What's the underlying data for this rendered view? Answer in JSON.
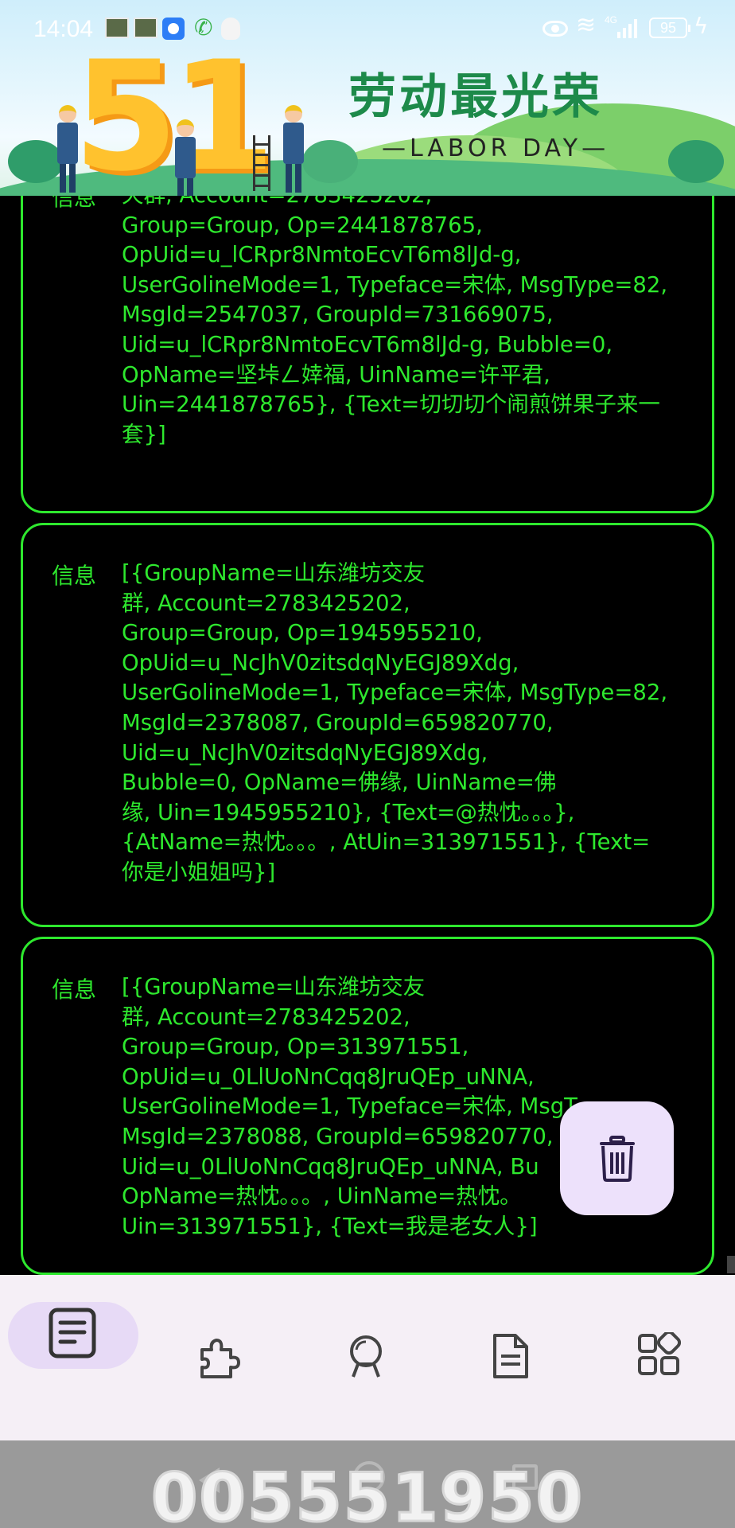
{
  "status_bar": {
    "time": "14:04",
    "network_label": "4G",
    "battery": "95"
  },
  "banner": {
    "big_number": "51",
    "slogan_cn": "劳动最光荣",
    "slogan_en": "—LABOR DAY—"
  },
  "messages": [
    {
      "label": "信息",
      "text": "天群, Account=2783425202,\nGroup=Group, Op=2441878765,\nOpUid=u_lCRpr8NmtoEcvT6m8lJd-g,\nUserGolineMode=1, Typeface=宋体, MsgType=82,\nMsgId=2547037, GroupId=731669075,\nUid=u_lCRpr8NmtoEcvT6m8lJd-g, Bubble=0,\nOpName=坚垰ㄥ婞福, UinName=许平君,\nUin=2441878765}, {Text=切切切个闹煎饼果子来一\n套}]"
    },
    {
      "label": "信息",
      "text": "[{GroupName=山东潍坊交友\n群, Account=2783425202,\nGroup=Group, Op=1945955210,\nOpUid=u_NcJhV0zitsdqNyEGJ89Xdg,\nUserGolineMode=1, Typeface=宋体, MsgType=82,\nMsgId=2378087, GroupId=659820770,\nUid=u_NcJhV0zitsdqNyEGJ89Xdg,\nBubble=0, OpName=佛缘, UinName=佛\n缘, Uin=1945955210}, {Text=@热忱。。。},\n{AtName=热忱。。。, AtUin=313971551}, {Text=\n你是小姐姐吗}]"
    },
    {
      "label": "信息",
      "text": "[{GroupName=山东潍坊交友\n群, Account=2783425202,\nGroup=Group, Op=313971551,\nOpUid=u_0LlUoNnCqq8JruQEp_uNNA,\nUserGolineMode=1, Typeface=宋体, MsgT\nMsgId=2378088, GroupId=659820770,\nUid=u_0LlUoNnCqq8JruQEp_uNNA, Bu\nOpName=热忱。。。, UinName=热忱。\nUin=313971551}, {Text=我是老女人}]"
    }
  ],
  "icons": {
    "fab": "trash-icon",
    "nav": [
      "log-list-icon",
      "plugin-icon",
      "robot-icon",
      "document-icon",
      "apps-grid-icon"
    ]
  },
  "colors": {
    "accent_text": "#2ee82e",
    "nav_bg": "#f5eff6",
    "nav_selected_pill": "#e7daf6",
    "fab_bg": "#ede1fb"
  },
  "watermark": "005551950"
}
